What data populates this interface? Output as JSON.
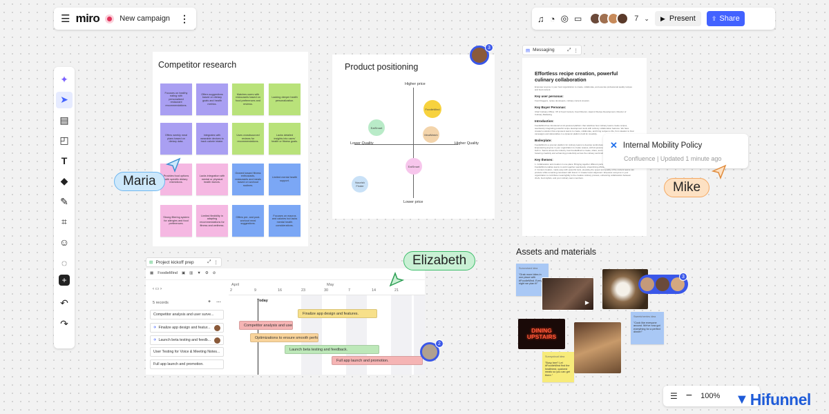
{
  "header": {
    "logo": "miro",
    "board_name": "New campaign",
    "collaborator_count": "7",
    "present_label": "Present",
    "share_label": "Share"
  },
  "toolbar": {
    "tools": [
      "sparkle-icon",
      "select-icon",
      "template-icon",
      "sticky-note-icon",
      "text-icon",
      "shapes-icon",
      "pen-icon",
      "frame-icon",
      "sticker-icon",
      "comment-icon",
      "add-icon",
      "undo-icon",
      "redo-icon"
    ]
  },
  "competitor": {
    "title": "Competitor research",
    "notes": [
      {
        "text": "Focuses on healthy eating with personalized restaurant recommendations.",
        "color": "#a99ff2"
      },
      {
        "text": "Offers suggestions based on dietary goals and health metrics.",
        "color": "#a99ff2"
      },
      {
        "text": "Matches users with restaurants based on food preferences and reviews.",
        "color": "#b9e27a"
      },
      {
        "text": "Lacking deeper health personalization.",
        "color": "#b9e27a"
      },
      {
        "text": "Offers weekly meal plans based on dietary data.",
        "color": "#a99ff2"
      },
      {
        "text": "Integrates with wearable devices to track calorie intake.",
        "color": "#a99ff2"
      },
      {
        "text": "Uses crowdsourced reviews for recommendations.",
        "color": "#b9e27a"
      },
      {
        "text": "Lacks detailed insights into users' health or fitness goals.",
        "color": "#b9e27a"
      },
      {
        "text": "Provides food options with specific dietary restrictions.",
        "color": "#f5b8e2"
      },
      {
        "text": "Lacks integration with mental or physical health factors.",
        "color": "#f5b8e2"
      },
      {
        "text": "Geared toward fitness enthusiasts, restaurants and meals based on workout routines.",
        "color": "#7ba7f5"
      },
      {
        "text": "Limited mental health support.",
        "color": "#7ba7f5"
      },
      {
        "text": "Strong filtering system for allergies and food preferences.",
        "color": "#f5b8e2"
      },
      {
        "text": "Limited flexibility in adapting recommendations for fitness and wellness.",
        "color": "#f5b8e2"
      },
      {
        "text": "Offers pre- and post-workout meal suggestions.",
        "color": "#7ba7f5"
      },
      {
        "text": "Focuses on macros and calories but lacks mental health considerations.",
        "color": "#7ba7f5"
      }
    ]
  },
  "positioning": {
    "title": "Product positioning",
    "comment_count": "3",
    "axis": {
      "top": "Higher price",
      "bottom": "Lower price",
      "left": "Lower Quality",
      "right": "Higher Quality"
    },
    "points": [
      {
        "label": "FoodieMind",
        "color": "#f7d23e"
      },
      {
        "label": "EatSmart",
        "color": "#b9ebc8"
      },
      {
        "label": "MealMatch",
        "color": "#f3d4ab"
      },
      {
        "label": "EatSmart",
        "color": "#f7c6ec"
      },
      {
        "label": "Nourish Finder",
        "color": "#c9e1f7"
      }
    ]
  },
  "doc": {
    "tab_label": "Messaging",
    "heading": "Effortless recipe creation, powerful culinary collaboration",
    "intro": "Empower anyone in your food organization to create, collaborate, and execute professional quality recipes and food content.",
    "sections": [
      {
        "h": "Key user personas:",
        "p": "Food bloggers, recipe developers, culinary content creators"
      },
      {
        "h": "Key Buyer Personas:",
        "p": "Chief Culinary Officer, VP of Food Content, Food Director, Head of Recipe Development, Director of Culinary Marketing"
      },
      {
        "h": "Introduction:",
        "p": "FoodieMind has introduced an AI-powered platform that redefines how culinary teams create recipes, seamlessly integrating powerful recipe development tools with culinary collaboration features. We have created a solution that empowers teams to create, collaborate, and bring recipes to life, from ideation to final campaigns and deliverables in a dynamic platform built for creativity."
      },
      {
        "h": "Boilerplate:",
        "p": "FoodieMind is a premier platform for culinary teams to develop world-class recipes and content. Empowering anyone in your organization to create recipes, with AI-powered tools and collaborative editing built in. Teams across the industry trust FoodieMind to create, share, and refine their work in one place, fostering creativity and enhancing productivity across the culinary world with FoodieMind."
      },
      {
        "h": "Key themes:",
        "p": "1. Collaboration and creation in one place: Bringing together different parts of the culinary workflow, FoodieMind enables teams to work together seamlessly, streamlining efficiency from concept to publication. 2. Content creation, made easy with powerful tools, elevating the speed and quality of the content teams can produce while remaining consistent with brand. 3. Greater team alignment: Empower everyone in your organization to contribute meaningfully to the creative culinary process, enhancing collaboration between chefs, food stylists, and your culinary team members."
      }
    ]
  },
  "confluence": {
    "title": "Internal Mobility Policy",
    "meta": "Confluence | Updated 1 minute ago"
  },
  "cursors": {
    "maria": "Maria",
    "mike": "Mike",
    "elizabeth": "Elizabeth"
  },
  "assets": {
    "title": "Assets and materials",
    "comment_count": "3",
    "sticky1_author": "Suncruised idea",
    "sticky1": "\"Grab more bites in one place with #FoodieMind. Every night we plan it!\"",
    "sticky2_author": "Sweetcherries idea",
    "sticky2": "\"Cook like everyone around. We've now got everything for a perfect dinner!\"",
    "sticky3_author": "Sunnycloud idea",
    "sticky3": "\"Busy bee? Let #FoodieMind find the healthiest, quickest meals so you can get there.\"",
    "neon": "DINING UPSTAIRS"
  },
  "kickoff": {
    "tab_label": "Project kickoff prep",
    "source": "FoodieMind",
    "records": "5 records",
    "today": "Today",
    "comment_count": "2",
    "months": [
      "April",
      "May"
    ],
    "days": [
      "2",
      "9",
      "16",
      "23",
      "30",
      "7",
      "14",
      "21"
    ],
    "rows": [
      "Competitor analysis and user surve...",
      "Finalize app design and featur...",
      "Launch beta testing and feedb...",
      "User Testing for Voice & Meeting Notes...",
      "Full app launch and promotion."
    ],
    "bars": [
      {
        "label": "Finalize app design and features.",
        "color": "#f7e08a"
      },
      {
        "label": "Competitor analysis and user...",
        "color": "#f5b4b4"
      },
      {
        "label": "Optimizations to ensure smooth perfo...",
        "color": "#f9d49b"
      },
      {
        "label": "Launch beta testing and feedback.",
        "color": "#bde8b9"
      },
      {
        "label": "Full app launch and promotion.",
        "color": "#f5b4b4"
      }
    ]
  },
  "zoom": {
    "value": "100%"
  },
  "watermark": "Hifunnel",
  "colors": {
    "accent": "#4262ff",
    "maria": "#6fb7f0",
    "mike": "#f4a862",
    "elizabeth": "#3dbd6a"
  }
}
